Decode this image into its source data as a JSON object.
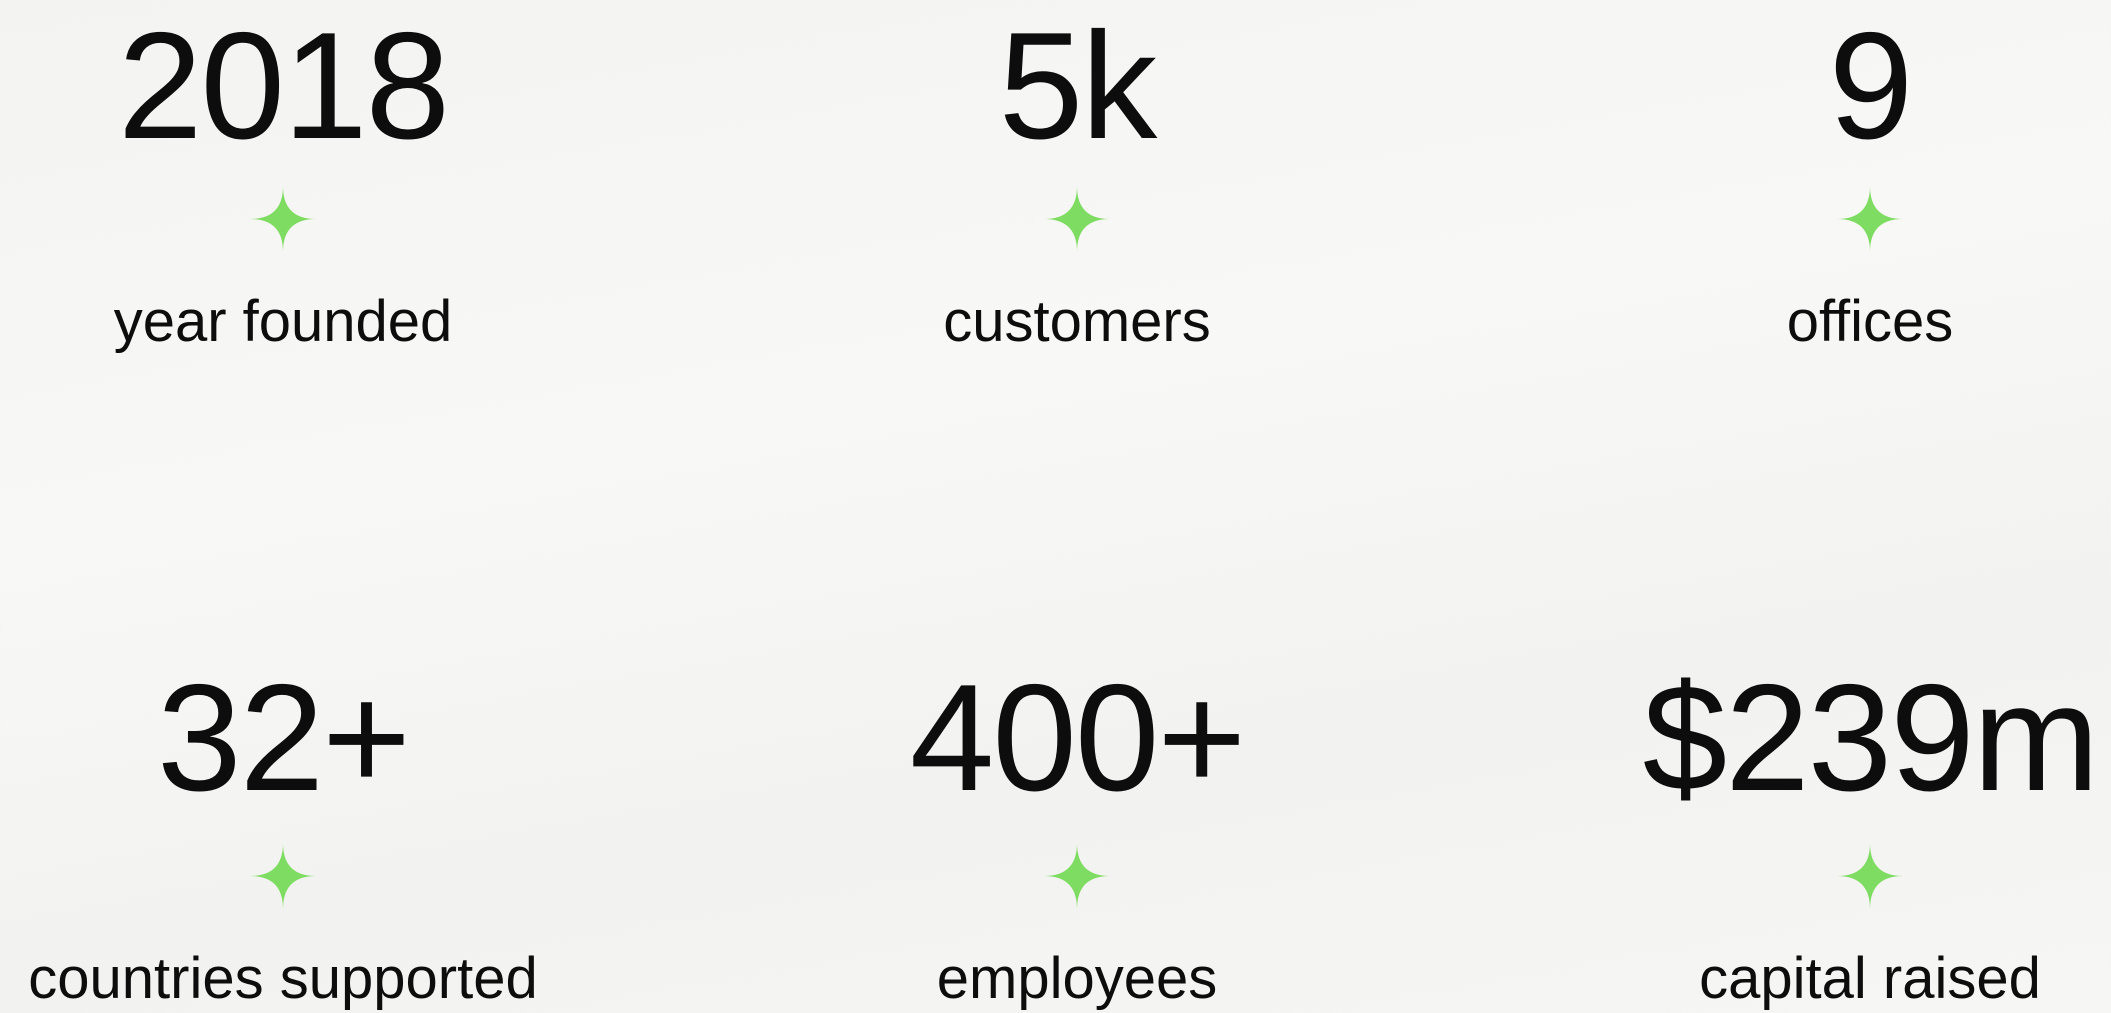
{
  "accent_color": "#7fdc63",
  "stats": [
    {
      "value": "2018",
      "label": "year founded",
      "icon": "sparkle-icon"
    },
    {
      "value": "5k",
      "label": "customers",
      "icon": "sparkle-icon"
    },
    {
      "value": "9",
      "label": "offices",
      "icon": "sparkle-icon"
    },
    {
      "value": "32+",
      "label": "countries supported",
      "icon": "sparkle-icon"
    },
    {
      "value": "400+",
      "label": "employees",
      "icon": "sparkle-icon"
    },
    {
      "value": "$239m",
      "label": "capital raised",
      "icon": "sparkle-icon"
    }
  ]
}
